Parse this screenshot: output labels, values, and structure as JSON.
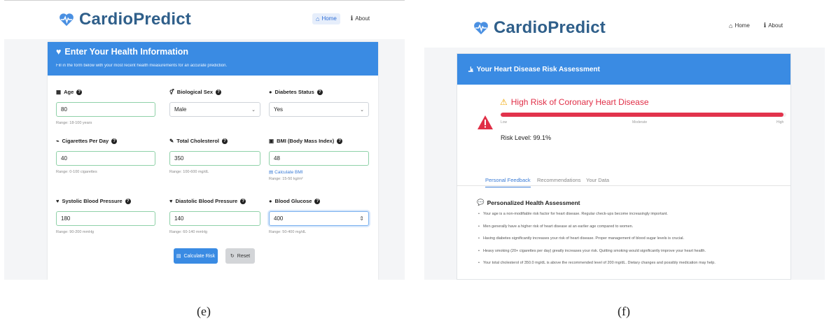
{
  "colors": {
    "brand": "#2f5f8a",
    "accent": "#3a8be3",
    "danger": "#e2334c",
    "heart": "#4a90e2"
  },
  "left": {
    "brand": "CardioPredict",
    "nav": {
      "home": "Home",
      "about": "About"
    },
    "form_title": "Enter Your Health Information",
    "form_subtitle": "Fill in the form below with your most recent health measurements for an accurate prediction.",
    "fields": {
      "age": {
        "label": "Age",
        "value": "80",
        "hint": "Range: 18-100 years"
      },
      "sex": {
        "label": "Biological Sex",
        "value": "Male"
      },
      "diabetes": {
        "label": "Diabetes Status",
        "value": "Yes"
      },
      "cigs": {
        "label": "Cigarettes Per Day",
        "value": "40",
        "hint": "Range: 0-100 cigarettes"
      },
      "chol": {
        "label": "Total Cholesterol",
        "value": "350",
        "hint": "Range: 100-600 mg/dL"
      },
      "bmi": {
        "label": "BMI (Body Mass Index)",
        "value": "48",
        "link": "Calculate BMI",
        "hint": "Range: 15-50 kg/m²"
      },
      "sbp": {
        "label": "Systolic Blood Pressure",
        "value": "180",
        "hint": "Range: 90-200 mmHg"
      },
      "dbp": {
        "label": "Diastolic Blood Pressure",
        "value": "140",
        "hint": "Range: 60-140 mmHg"
      },
      "glucose": {
        "label": "Blood Glucose",
        "value": "400",
        "hint": "Range: 50-400 mg/dL"
      }
    },
    "buttons": {
      "calculate": "Calculate Risk",
      "reset": "Reset"
    },
    "caption": "(e)"
  },
  "right": {
    "brand": "CardioPredict",
    "nav": {
      "home": "Home",
      "about": "About"
    },
    "card_title": "Your Heart Disease Risk Assessment",
    "risk_title": "High Risk of Coronary Heart Disease",
    "risk_fraction": 0.991,
    "scale": {
      "low": "Low",
      "moderate": "Moderate",
      "high": "High"
    },
    "risk_level": "Risk Level: 99.1%",
    "tabs": [
      "Personal Feedback",
      "Recommendations",
      "Your Data"
    ],
    "feedback_title": "Personalized Health Assessment",
    "feedback_items": [
      "Your age is a non-modifiable risk factor for heart disease. Regular check-ups become increasingly important.",
      "Men generally have a higher risk of heart disease at an earlier age compared to women.",
      "Having diabetes significantly increases your risk of heart disease. Proper management of blood sugar levels is crucial.",
      "Heavy smoking (20+ cigarettes per day) greatly increases your risk. Quitting smoking would significantly improve your heart health.",
      "Your total cholesterol of 350.0 mg/dL is above the recommended level of 200 mg/dL. Dietary changes and possibly medication may help."
    ],
    "caption": "(f)"
  }
}
